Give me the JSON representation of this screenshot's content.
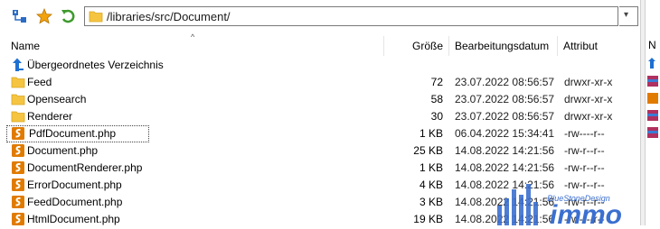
{
  "toolbar": {
    "buttons": [
      {
        "name": "directory-tree-icon"
      },
      {
        "name": "bookmark-star-icon"
      },
      {
        "name": "refresh-icon"
      }
    ],
    "path": "/libraries/src/Document/",
    "dropdown_glyph": "▾"
  },
  "columns": {
    "name": "Name",
    "size": "Größe",
    "date": "Bearbeitungsdatum",
    "attr": "Attribut",
    "sort_glyph": "^"
  },
  "rows": [
    {
      "name": "Übergeordnetes Verzeichnis",
      "type": "parent",
      "size": "",
      "date": "",
      "attr": ""
    },
    {
      "name": "Feed",
      "type": "folder",
      "size": "72",
      "date": "23.07.2022 08:56:57",
      "attr": "drwxr-xr-x"
    },
    {
      "name": "Opensearch",
      "type": "folder",
      "size": "58",
      "date": "23.07.2022 08:56:57",
      "attr": "drwxr-xr-x"
    },
    {
      "name": "Renderer",
      "type": "folder",
      "size": "30",
      "date": "23.07.2022 08:56:57",
      "attr": "drwxr-xr-x"
    },
    {
      "name": "PdfDocument.php",
      "type": "php",
      "size": "1 KB",
      "date": "06.04.2022 15:34:41",
      "attr": "-rw----r--",
      "focused": true
    },
    {
      "name": "Document.php",
      "type": "php",
      "size": "25 KB",
      "date": "14.08.2022 14:21:56",
      "attr": "-rw-r--r--"
    },
    {
      "name": "DocumentRenderer.php",
      "type": "php",
      "size": "1 KB",
      "date": "14.08.2022 14:21:56",
      "attr": "-rw-r--r--"
    },
    {
      "name": "ErrorDocument.php",
      "type": "php",
      "size": "4 KB",
      "date": "14.08.2022 14:21:56",
      "attr": "-rw-r--r--"
    },
    {
      "name": "FeedDocument.php",
      "type": "php",
      "size": "3 KB",
      "date": "14.08.2022 14:21:56",
      "attr": "-rw-r--r--"
    },
    {
      "name": "HtmlDocument.php",
      "type": "php",
      "size": "19 KB",
      "date": "14.08.2022 14:21:56",
      "attr": "-rw-r--r--"
    }
  ],
  "right_pane": {
    "header_label": "N"
  },
  "watermark": {
    "tagline": "BlueStoneDesign",
    "brand": "immo"
  },
  "colors": {
    "folder": "#f5c542",
    "php_icon": "#e07b00",
    "accent_blue": "#1f6fd1"
  }
}
